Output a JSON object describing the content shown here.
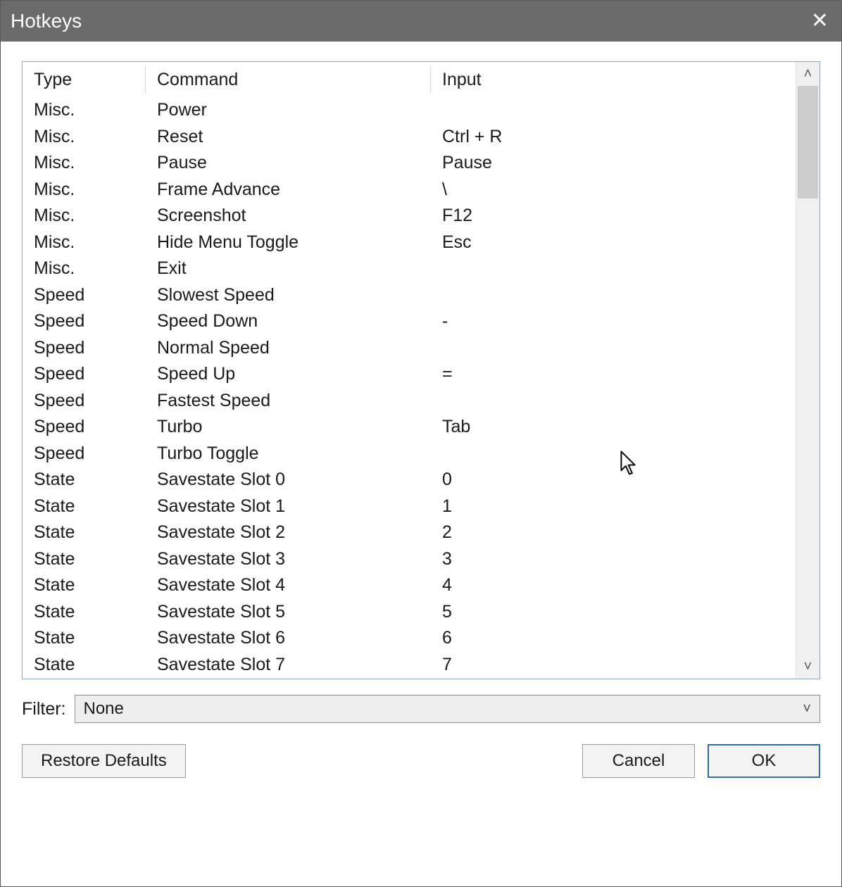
{
  "window": {
    "title": "Hotkeys"
  },
  "columns": {
    "type": "Type",
    "command": "Command",
    "input": "Input"
  },
  "rows": [
    {
      "type": "Misc.",
      "command": "Power",
      "input": ""
    },
    {
      "type": "Misc.",
      "command": "Reset",
      "input": "Ctrl + R"
    },
    {
      "type": "Misc.",
      "command": "Pause",
      "input": "Pause"
    },
    {
      "type": "Misc.",
      "command": "Frame Advance",
      "input": "\\"
    },
    {
      "type": "Misc.",
      "command": "Screenshot",
      "input": "F12"
    },
    {
      "type": "Misc.",
      "command": "Hide Menu Toggle",
      "input": "Esc"
    },
    {
      "type": "Misc.",
      "command": "Exit",
      "input": ""
    },
    {
      "type": "Speed",
      "command": "Slowest Speed",
      "input": ""
    },
    {
      "type": "Speed",
      "command": "Speed Down",
      "input": "-"
    },
    {
      "type": "Speed",
      "command": "Normal Speed",
      "input": ""
    },
    {
      "type": "Speed",
      "command": "Speed Up",
      "input": "="
    },
    {
      "type": "Speed",
      "command": "Fastest Speed",
      "input": ""
    },
    {
      "type": "Speed",
      "command": "Turbo",
      "input": "Tab"
    },
    {
      "type": "Speed",
      "command": "Turbo Toggle",
      "input": ""
    },
    {
      "type": "State",
      "command": "Savestate Slot 0",
      "input": "0"
    },
    {
      "type": "State",
      "command": "Savestate Slot 1",
      "input": "1"
    },
    {
      "type": "State",
      "command": "Savestate Slot 2",
      "input": "2"
    },
    {
      "type": "State",
      "command": "Savestate Slot 3",
      "input": "3"
    },
    {
      "type": "State",
      "command": "Savestate Slot 4",
      "input": "4"
    },
    {
      "type": "State",
      "command": "Savestate Slot 5",
      "input": "5"
    },
    {
      "type": "State",
      "command": "Savestate Slot 6",
      "input": "6"
    },
    {
      "type": "State",
      "command": "Savestate Slot 7",
      "input": "7"
    }
  ],
  "filter": {
    "label": "Filter:",
    "value": "None"
  },
  "buttons": {
    "restore": "Restore Defaults",
    "cancel": "Cancel",
    "ok": "OK"
  }
}
